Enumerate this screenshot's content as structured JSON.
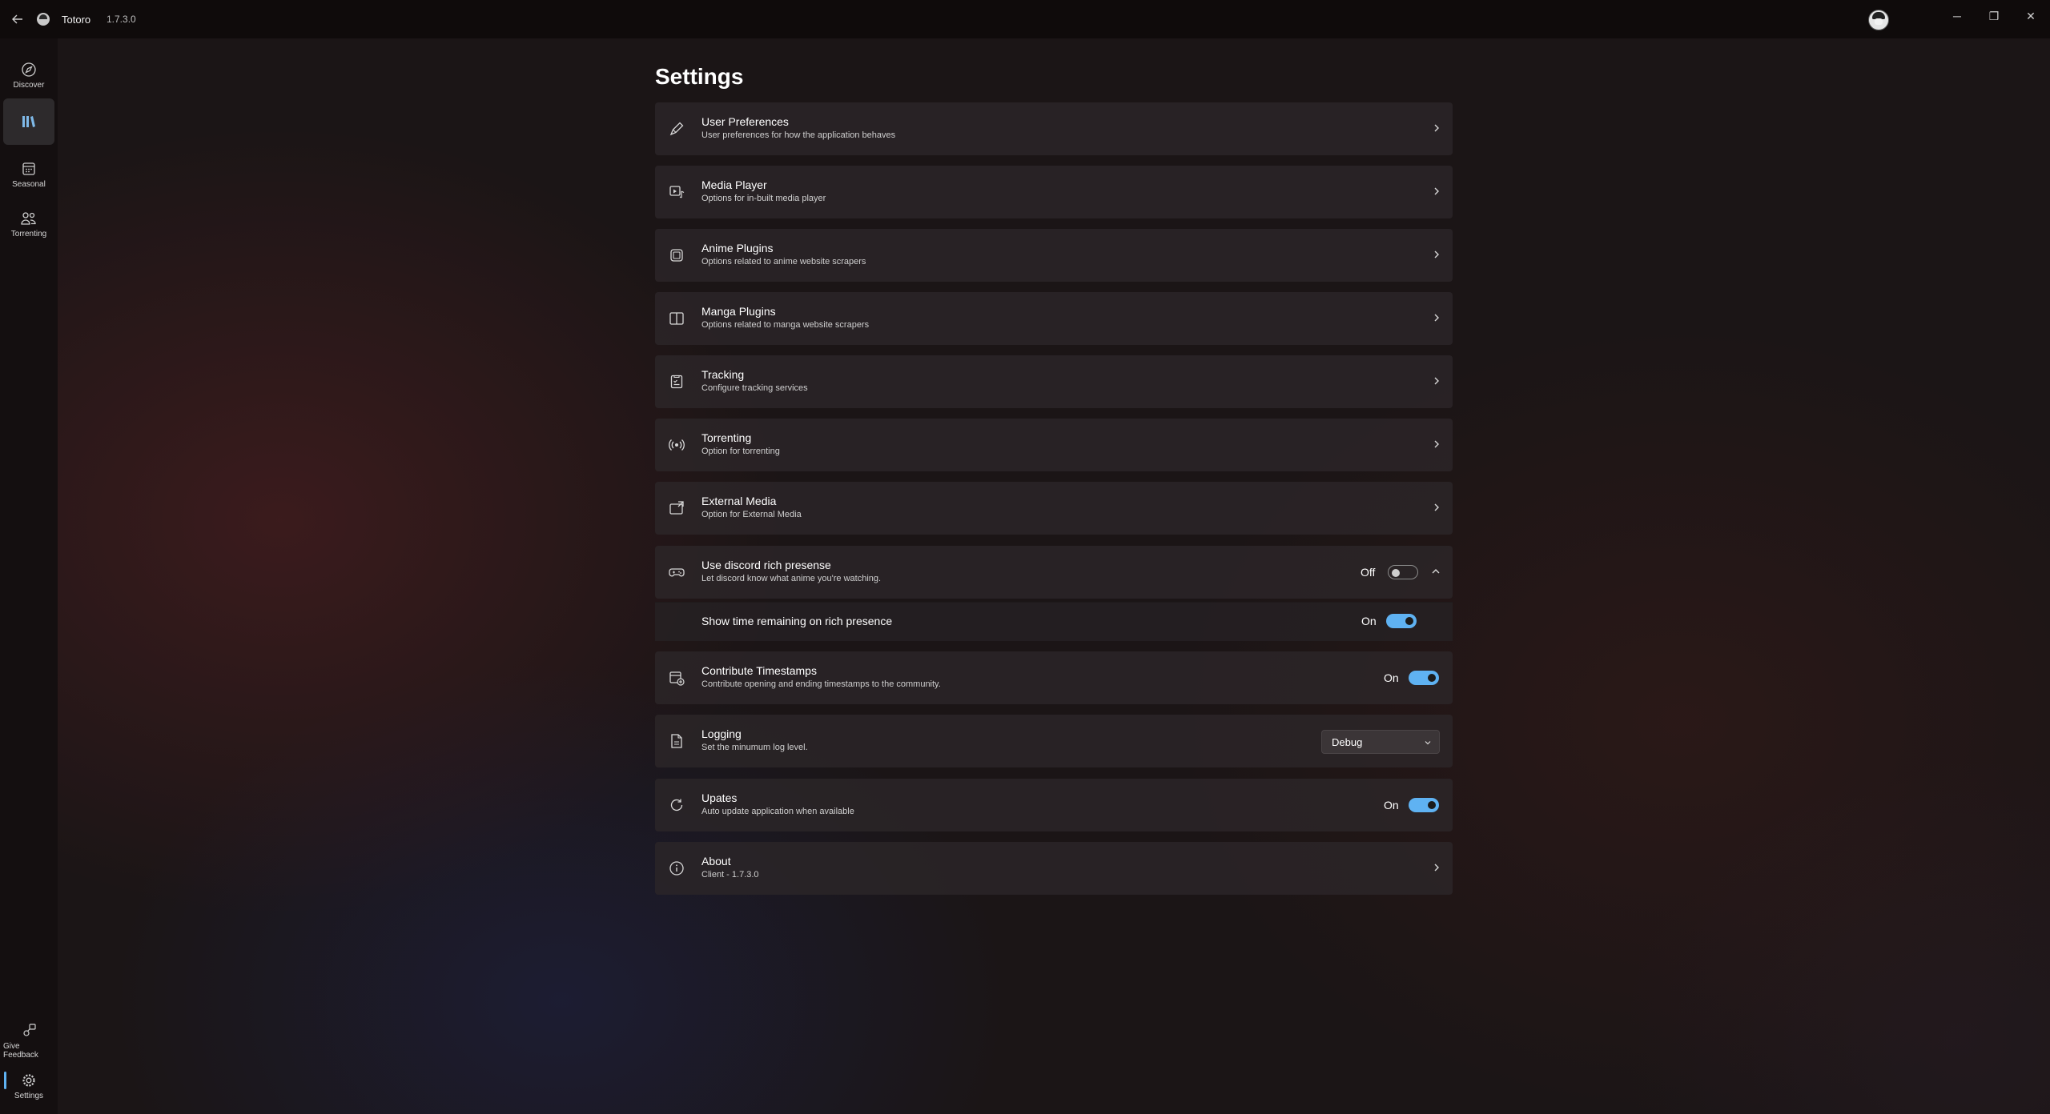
{
  "app": {
    "title": "Totoro",
    "version": "1.7.3.0"
  },
  "window": {
    "minimize": "─",
    "maximize": "❐",
    "close": "✕"
  },
  "sidebar": {
    "items": [
      {
        "label": "Discover",
        "icon": "discover-icon"
      },
      {
        "label": "",
        "icon": "library-icon",
        "active": true
      },
      {
        "label": "Seasonal",
        "icon": "calendar-icon"
      },
      {
        "label": "Torrenting",
        "icon": "people-icon"
      }
    ],
    "footer": [
      {
        "label": "Give Feedback",
        "icon": "feedback-icon"
      },
      {
        "label": "Settings",
        "icon": "gear-icon",
        "active": true
      }
    ]
  },
  "page": {
    "title": "Settings"
  },
  "settings": {
    "user_preferences": {
      "title": "User Preferences",
      "desc": "User preferences for how the application behaves"
    },
    "media_player": {
      "title": "Media Player",
      "desc": "Options for in-built media player"
    },
    "anime_plugins": {
      "title": "Anime Plugins",
      "desc": "Options related to anime website scrapers"
    },
    "manga_plugins": {
      "title": "Manga Plugins",
      "desc": "Options related to manga website scrapers"
    },
    "tracking": {
      "title": "Tracking",
      "desc": "Configure tracking services"
    },
    "torrenting": {
      "title": "Torrenting",
      "desc": "Option for torrenting"
    },
    "external_media": {
      "title": "External Media",
      "desc": "Option for External Media"
    },
    "discord": {
      "title": "Use discord rich presense",
      "desc": "Let discord know what anime you're watching.",
      "state": "Off",
      "sub": {
        "title": "Show time remaining on rich presence",
        "state": "On"
      }
    },
    "timestamps": {
      "title": "Contribute Timestamps",
      "desc": "Contribute opening and ending timestamps to the community.",
      "state": "On"
    },
    "logging": {
      "title": "Logging",
      "desc": "Set the minumum log level.",
      "value": "Debug"
    },
    "updates": {
      "title": "Upates",
      "desc": "Auto update application when available",
      "state": "On"
    },
    "about": {
      "title": "About",
      "desc": "Client - 1.7.3.0"
    }
  },
  "colors": {
    "accent": "#5fb2f2",
    "card": "#2c2628",
    "background": "#1b1516"
  }
}
